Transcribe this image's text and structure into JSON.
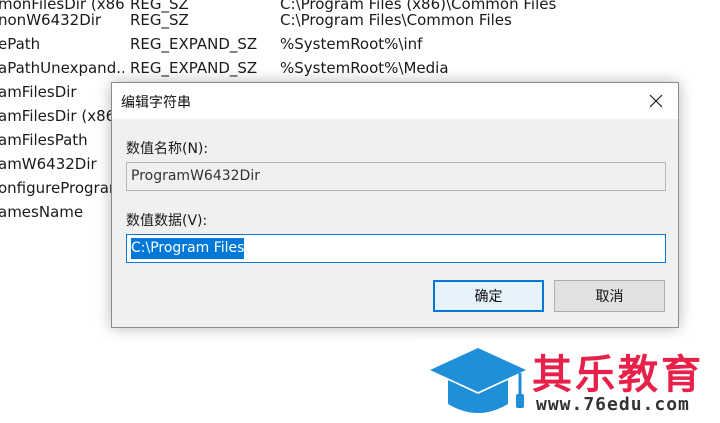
{
  "registry_list": {
    "rows": [
      {
        "name": "monFilesDir (x86)",
        "type": "REG_SZ",
        "data": "C:\\Program Files (x86)\\Common Files"
      },
      {
        "name": "nonW6432Dir",
        "type": "REG_SZ",
        "data": "C:\\Program Files\\Common Files"
      },
      {
        "name": "ePath",
        "type": "REG_EXPAND_SZ",
        "data": "%SystemRoot%\\inf"
      },
      {
        "name": "aPathUnexpand...",
        "type": "REG_EXPAND_SZ",
        "data": "%SystemRoot%\\Media"
      },
      {
        "name": "amFilesDir",
        "type": "",
        "data": ""
      },
      {
        "name": "amFilesDir (x86)",
        "type": "",
        "data": ""
      },
      {
        "name": "amFilesPath",
        "type": "",
        "data": ""
      },
      {
        "name": "amW6432Dir",
        "type": "",
        "data": ""
      },
      {
        "name": "onfigurePrograr",
        "type": "",
        "data": ""
      },
      {
        "name": "amesName",
        "type": "",
        "data": ""
      }
    ]
  },
  "dialog": {
    "title": "编辑字符串",
    "value_name_label": "数值名称(N):",
    "value_name": "ProgramW6432Dir",
    "value_data_label": "数值数据(V):",
    "value_data": "C:\\Program Files",
    "ok_label": "确定",
    "cancel_label": "取消"
  },
  "watermark": {
    "brand_name": "其乐教育",
    "url": "www.76edu.com"
  },
  "colors": {
    "accent": "#0078d7",
    "brand_red": "#e8214b",
    "brand_blue": "#1f8fd9"
  },
  "icons": {
    "close": "close-icon",
    "logo": "graduation-cap-icon"
  }
}
